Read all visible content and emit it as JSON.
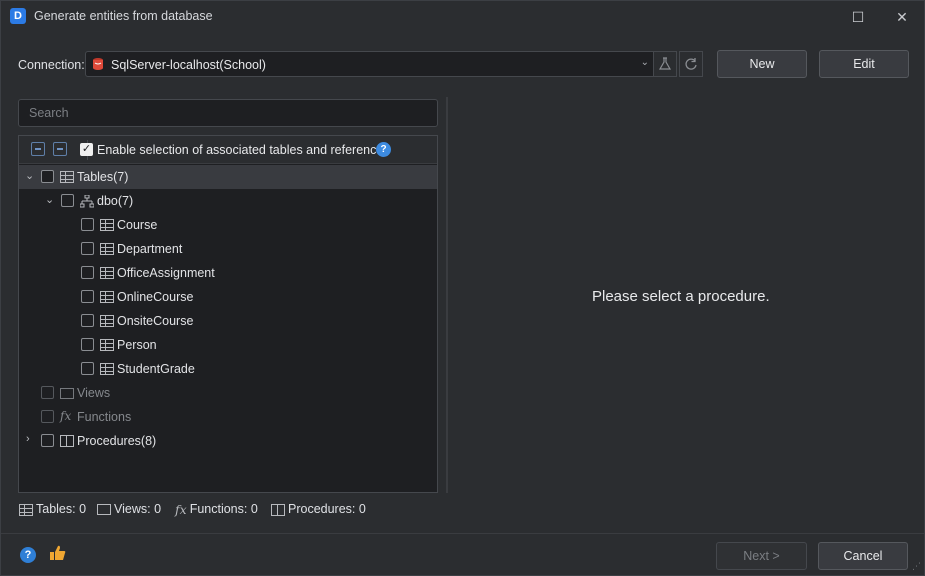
{
  "window": {
    "title": "Generate entities from database",
    "maximize_glyph": "☐",
    "close_glyph": "✕"
  },
  "connection": {
    "label": "Connection:",
    "value": "SqlServer-localhost(School)",
    "new_label": "New",
    "edit_label": "Edit"
  },
  "search": {
    "placeholder": "Search"
  },
  "tree_toolbar": {
    "enable_label": "Enable selection of associated tables and references",
    "enable_checked": true,
    "help_glyph": "?"
  },
  "tree": {
    "tables_label": "Tables(7)",
    "schema_label": "dbo(7)",
    "tables": [
      "Course",
      "Department",
      "OfficeAssignment",
      "OnlineCourse",
      "OnsiteCourse",
      "Person",
      "StudentGrade"
    ],
    "views_label": "Views",
    "functions_label": "Functions",
    "functions_glyph": "fx",
    "procedures_label": "Procedures(8)"
  },
  "details": {
    "message": "Please select a procedure."
  },
  "counts": {
    "tables": "Tables: 0",
    "views": "Views: 0",
    "functions": "Functions: 0",
    "procedures": "Procedures: 0"
  },
  "footer": {
    "next_label": "Next >",
    "cancel_label": "Cancel",
    "help_glyph": "?"
  },
  "colors": {
    "background": "#2b2d30",
    "panel": "#1e1f22",
    "accent": "#3d8be0",
    "thumb": "#f0a732"
  },
  "icons": [
    "app-icon",
    "maximize-icon",
    "close-icon",
    "database-icon",
    "chevron-down-icon",
    "flask-icon",
    "refresh-icon",
    "collapse-all-icon",
    "expand-all-icon",
    "help-icon",
    "table-icon",
    "schema-icon",
    "view-icon",
    "function-icon",
    "procedure-icon",
    "thumbs-up-icon",
    "resize-grip-icon"
  ]
}
